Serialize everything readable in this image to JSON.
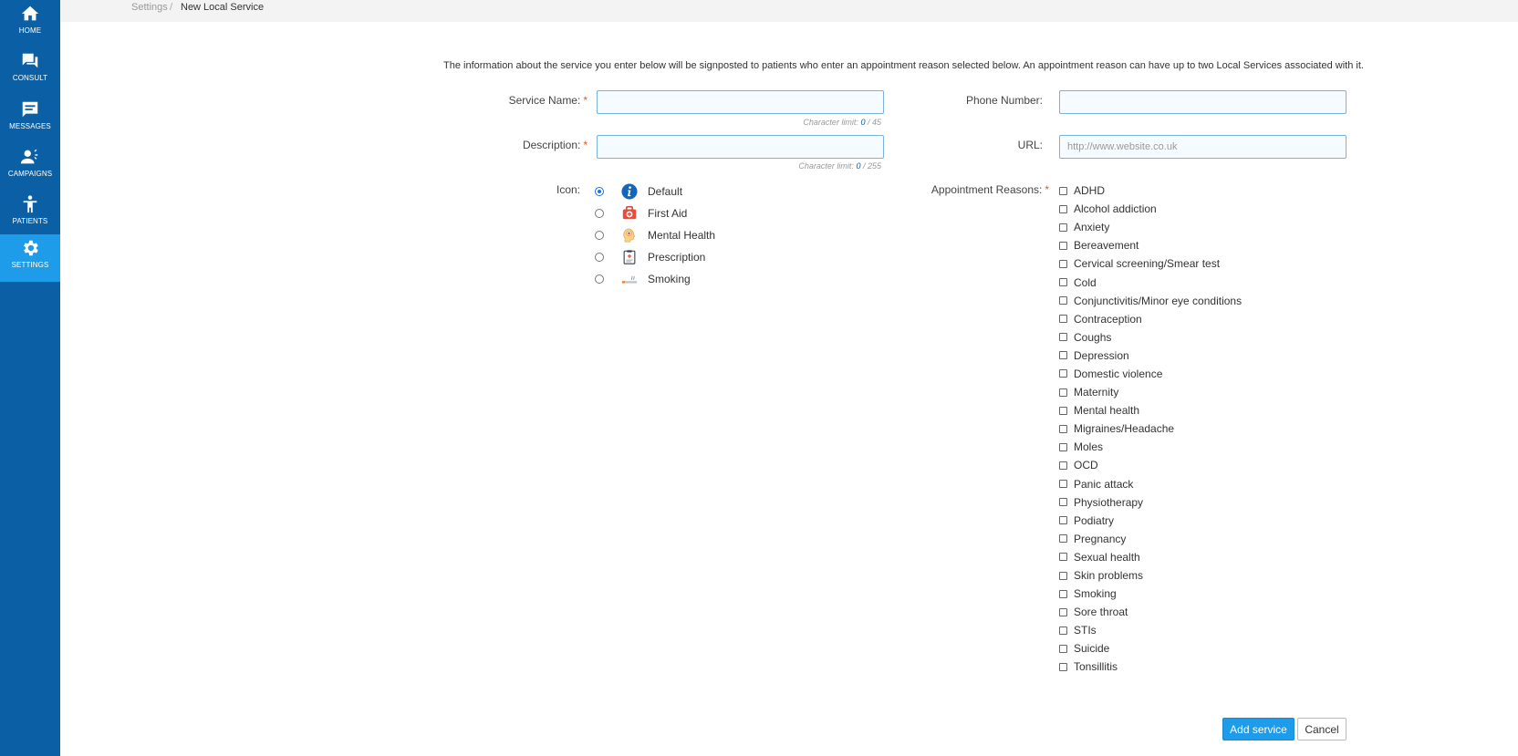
{
  "sidebar": {
    "items": [
      {
        "label": "HOME",
        "icon": "home-icon"
      },
      {
        "label": "CONSULT",
        "icon": "chat-icon"
      },
      {
        "label": "MESSAGES",
        "icon": "message-icon"
      },
      {
        "label": "CAMPAIGNS",
        "icon": "campaign-icon"
      },
      {
        "label": "PATIENTS",
        "icon": "person-icon"
      },
      {
        "label": "SETTINGS",
        "icon": "gear-icon",
        "active": true
      }
    ]
  },
  "breadcrumb": {
    "parent": "Settings",
    "separator": "/",
    "current": "New Local Service"
  },
  "form": {
    "intro": "The information about the service you enter below will be signposted to patients who enter an appointment reason selected below. An appointment reason can have up to two Local Services associated with it.",
    "required_marker": "*",
    "service_name": {
      "label": "Service Name:",
      "value": "",
      "char_count": "0",
      "char_max": "45",
      "char_prefix": "Character limit:"
    },
    "description": {
      "label": "Description:",
      "value": "",
      "char_count": "0",
      "char_max": "255",
      "char_prefix": "Character limit:"
    },
    "phone": {
      "label": "Phone Number:",
      "value": ""
    },
    "url": {
      "label": "URL:",
      "value": "",
      "placeholder": "http://www.website.co.uk"
    },
    "icon": {
      "label": "Icon:",
      "options": [
        {
          "label": "Default",
          "icon": "info-icon",
          "selected": true
        },
        {
          "label": "First Aid",
          "icon": "first-aid-icon",
          "selected": false
        },
        {
          "label": "Mental Health",
          "icon": "mental-health-icon",
          "selected": false
        },
        {
          "label": "Prescription",
          "icon": "prescription-icon",
          "selected": false
        },
        {
          "label": "Smoking",
          "icon": "smoking-icon",
          "selected": false
        }
      ]
    },
    "reasons": {
      "label": "Appointment Reasons:",
      "items": [
        "ADHD",
        "Alcohol addiction",
        "Anxiety",
        "Bereavement",
        "Cervical screening/Smear test",
        "Cold",
        "Conjunctivitis/Minor eye conditions",
        "Contraception",
        "Coughs",
        "Depression",
        "Domestic violence",
        "Maternity",
        "Mental health",
        "Migraines/Headache",
        "Moles",
        "OCD",
        "Panic attack",
        "Physiotherapy",
        "Podiatry",
        "Pregnancy",
        "Sexual health",
        "Skin problems",
        "Smoking",
        "Sore throat",
        "STIs",
        "Suicide",
        "Tonsillitis"
      ]
    }
  },
  "actions": {
    "add_label": "Add service",
    "cancel_label": "Cancel"
  },
  "colors": {
    "sidebar": "#0b5fa5",
    "sidebar_active": "#1e9be9",
    "primary_button": "#1e9be9",
    "required": "#e3571f"
  }
}
